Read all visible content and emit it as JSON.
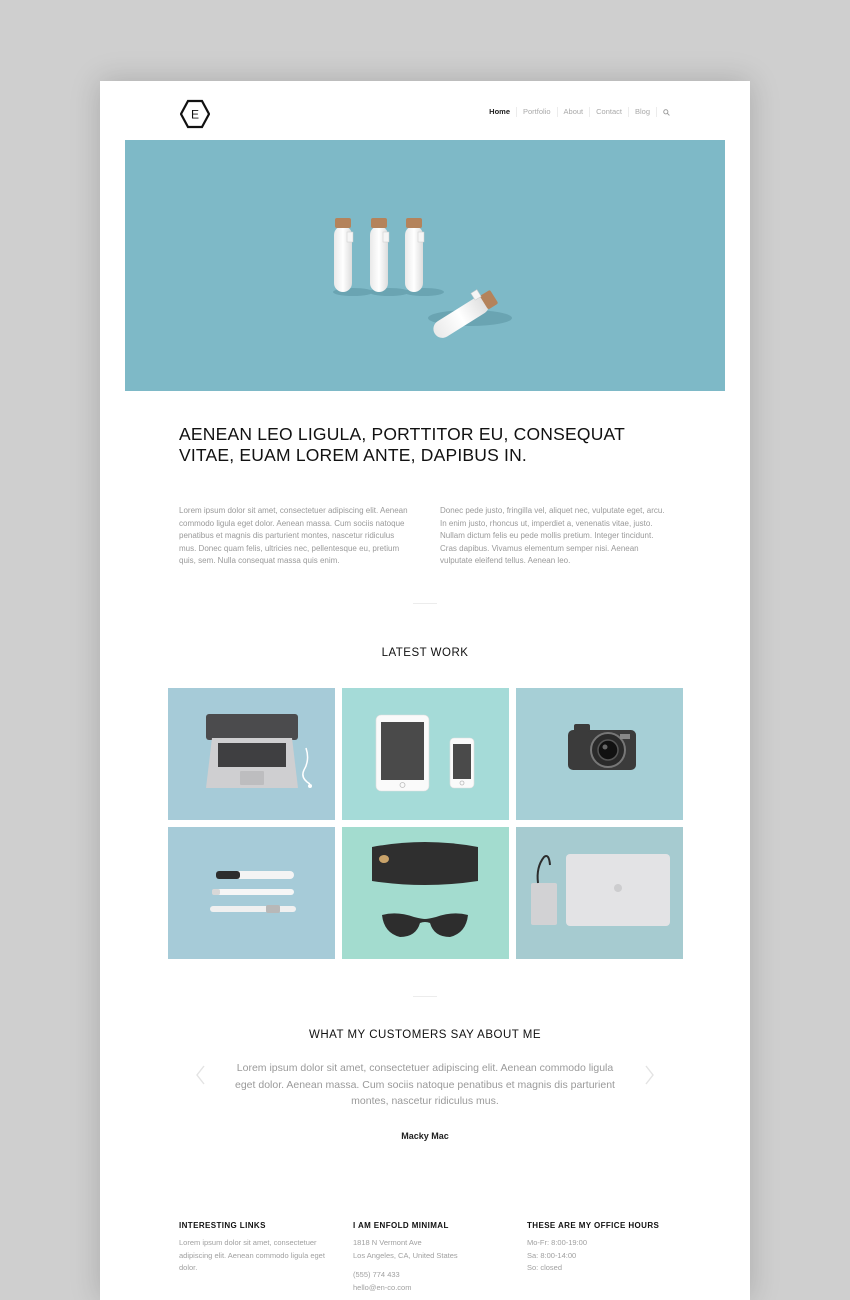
{
  "nav": {
    "logo_letter": "E",
    "items": [
      "Home",
      "Portfolio",
      "About",
      "Contact",
      "Blog"
    ]
  },
  "intro": {
    "headline": "Aenean leo ligula, porttitor eu, consequat vitae, euam lorem ante, dapibus in.",
    "col_left": "Lorem ipsum dolor sit amet, consectetuer adipiscing elit. Aenean commodo ligula eget dolor. Aenean massa. Cum sociis natoque penatibus et magnis dis parturient montes, nascetur ridiculus mus. Donec quam felis, ultricies nec, pellentesque eu, pretium quis, sem. Nulla consequat massa quis enim.",
    "col_right": "Donec pede justo, fringilla vel, aliquet nec, vulputate eget, arcu. In enim justo, rhoncus ut, imperdiet a, venenatis vitae, justo. Nullam dictum felis eu pede mollis pretium. Integer tincidunt. Cras dapibus. Vivamus elementum semper nisi. Aenean vulputate eleifend tellus. Aenean leo."
  },
  "latest_work": {
    "title": "Latest Work"
  },
  "testimonials": {
    "title": "What my customers say about me",
    "quote": "Lorem ipsum dolor sit amet, consectetuer adipiscing elit. Aenean commodo ligula eget dolor. Aenean massa. Cum sociis natoque penatibus et magnis dis parturient montes, nascetur ridiculus mus.",
    "author": "Macky Mac"
  },
  "footer": {
    "links_title": "Interesting Links",
    "links_text": "Lorem ipsum dolor sit amet, consectetuer adipiscing elit. Aenean commodo ligula eget dolor.",
    "about_title": "I am Enfold Minimal",
    "address_line1": "1818 N Vermont Ave",
    "address_line2": "Los Angeles, CA, United States",
    "phone": "(555) 774 433",
    "email": "hello@en-co.com",
    "hours_title": "These are my office hours",
    "hours_1": "Mo-Fr: 8:00-19:00",
    "hours_2": "Sa: 8:00-14:00",
    "hours_3": "So: closed"
  },
  "colors": {
    "hero_bg": "#7eb9c7",
    "tile_blue": "#a6cbd8",
    "tile_teal": "#a5dbd8",
    "tile_mint": "#a3dccf"
  }
}
